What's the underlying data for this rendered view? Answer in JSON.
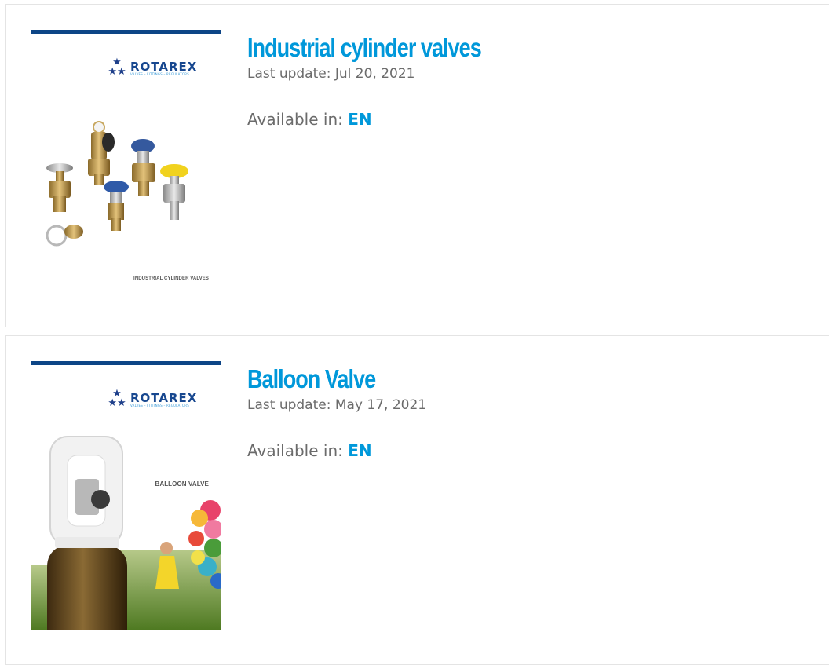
{
  "documents": [
    {
      "title": "Industrial cylinder valves",
      "last_update": "Last update: Jul 20, 2021",
      "available_label": "Available in:",
      "languages": [
        "EN"
      ],
      "cover": {
        "brand": "ROTAREX",
        "tagline": "VALVES – FITTINGS – REGULATORS",
        "caption": "INDUSTRIAL CYLINDER VALVES"
      }
    },
    {
      "title": "Balloon Valve",
      "last_update": "Last update: May 17, 2021",
      "available_label": "Available in:",
      "languages": [
        "EN"
      ],
      "cover": {
        "brand": "ROTAREX",
        "tagline": "VALVES – FITTINGS – REGULATORS",
        "caption": "BALLOON VALVE"
      }
    }
  ],
  "colors": {
    "title": "#0098da",
    "link": "#0098da",
    "text": "#6b6b6b",
    "brand_bar": "#0d4586",
    "border": "#e4e4e4"
  }
}
